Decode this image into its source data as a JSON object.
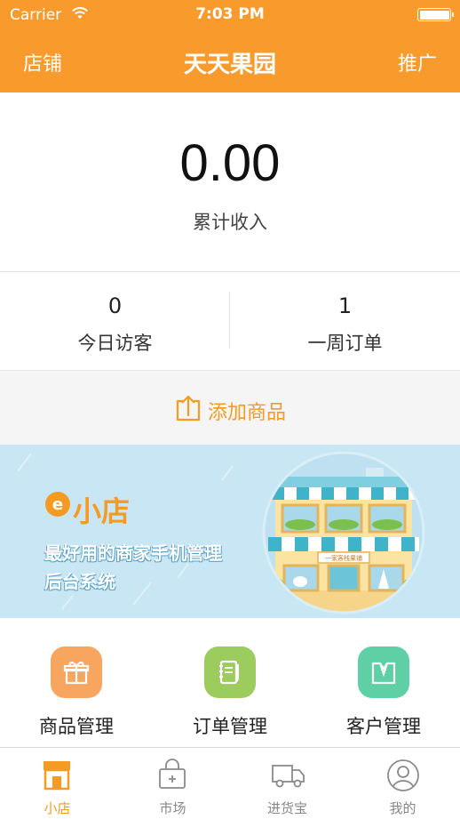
{
  "status_bar": {
    "carrier": "Carrier",
    "time": "7:03 PM"
  },
  "nav": {
    "left": "店铺",
    "title": "天天果园",
    "right": "推广"
  },
  "income": {
    "value": "0.00",
    "label": "累计收入"
  },
  "stats": [
    {
      "value": "0",
      "label": "今日访客"
    },
    {
      "value": "1",
      "label": "一周订单"
    }
  ],
  "add_product": {
    "label": "添加商品"
  },
  "banner": {
    "brand": "小店",
    "logo_letter": "e",
    "slogan_line1": "最好用的商家手机管理",
    "slogan_line2": "后台系统",
    "shop_sign": "一家客栈果铺"
  },
  "shortcuts": [
    {
      "label": "商品管理",
      "icon": "gift-icon",
      "color": "#f8a55f"
    },
    {
      "label": "订单管理",
      "icon": "notebook-icon",
      "color": "#9ccb5e"
    },
    {
      "label": "客户管理",
      "icon": "suit-icon",
      "color": "#5fd0a6"
    }
  ],
  "tabs": [
    {
      "label": "小店",
      "icon": "shop-icon",
      "active": true
    },
    {
      "label": "市场",
      "icon": "shopping-bag-icon",
      "active": false
    },
    {
      "label": "进货宝",
      "icon": "truck-icon",
      "active": false
    },
    {
      "label": "我的",
      "icon": "user-icon",
      "active": false
    }
  ],
  "colors": {
    "brand_orange": "#f99a2c",
    "accent_orange": "#f59a23",
    "banner_blue": "#c8e6f3"
  }
}
